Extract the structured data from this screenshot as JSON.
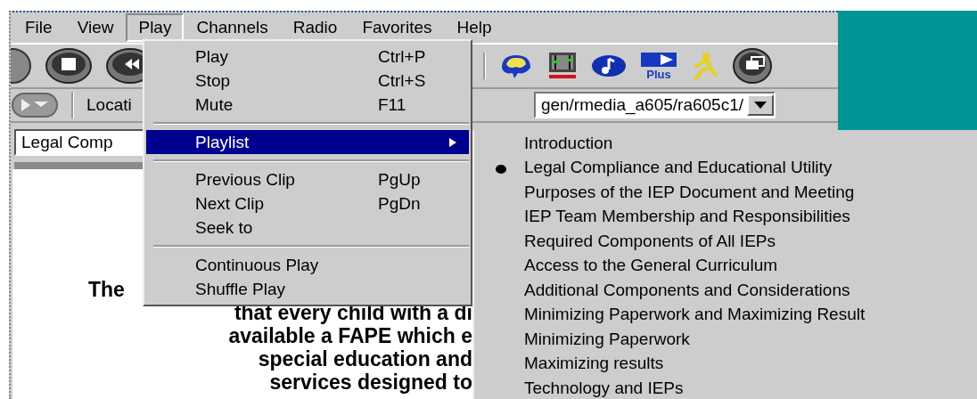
{
  "menu_bar": [
    {
      "label": "File",
      "selected": false
    },
    {
      "label": "View",
      "selected": false
    },
    {
      "label": "Play",
      "selected": true
    },
    {
      "label": "Channels",
      "selected": false
    },
    {
      "label": "Radio",
      "selected": false
    },
    {
      "label": "Favorites",
      "selected": false
    },
    {
      "label": "Help",
      "selected": false
    }
  ],
  "toolbar": {
    "logo_text": "Plus"
  },
  "location": {
    "label": "Locati",
    "value": "gen/rmedia_a605/ra605c1/"
  },
  "clip_field": {
    "value": "Legal Comp"
  },
  "content_lines": [
    "The",
    "that every child with a di",
    "available a FAPE which e",
    "special education and",
    "services designed to"
  ],
  "play_menu": [
    {
      "kind": "item",
      "label": "Play",
      "shortcut": "Ctrl+P",
      "selected": false
    },
    {
      "kind": "item",
      "label": "Stop",
      "shortcut": "Ctrl+S",
      "selected": false
    },
    {
      "kind": "item",
      "label": "Mute",
      "shortcut": "F11",
      "selected": false
    },
    {
      "kind": "separator"
    },
    {
      "kind": "submenu",
      "label": "Playlist",
      "selected": true
    },
    {
      "kind": "separator"
    },
    {
      "kind": "item",
      "label": "Previous Clip",
      "shortcut": "PgUp",
      "selected": false
    },
    {
      "kind": "item",
      "label": "Next Clip",
      "shortcut": "PgDn",
      "selected": false
    },
    {
      "kind": "item",
      "label": "Seek to",
      "selected": false
    },
    {
      "kind": "separator"
    },
    {
      "kind": "item",
      "label": "Continuous Play",
      "selected": false
    },
    {
      "kind": "item",
      "label": "Shuffle Play",
      "selected": false
    }
  ],
  "playlist": [
    {
      "label": "Introduction",
      "selected": false
    },
    {
      "label": "Legal Compliance and Educational Utility",
      "selected": true
    },
    {
      "label": "Purposes of the IEP Document and Meeting",
      "selected": false
    },
    {
      "label": "IEP Team Membership and Responsibilities",
      "selected": false
    },
    {
      "label": "Required Components of All IEPs",
      "selected": false
    },
    {
      "label": "Access to the General Curriculum",
      "selected": false
    },
    {
      "label": "Additional Components and Considerations",
      "selected": false
    },
    {
      "label": "Minimizing Paperwork and Maximizing Result",
      "selected": false
    },
    {
      "label": "Minimizing Paperwork",
      "selected": false
    },
    {
      "label": "Maximizing results",
      "selected": false
    },
    {
      "label": "Technology and IEPs",
      "selected": false
    }
  ]
}
